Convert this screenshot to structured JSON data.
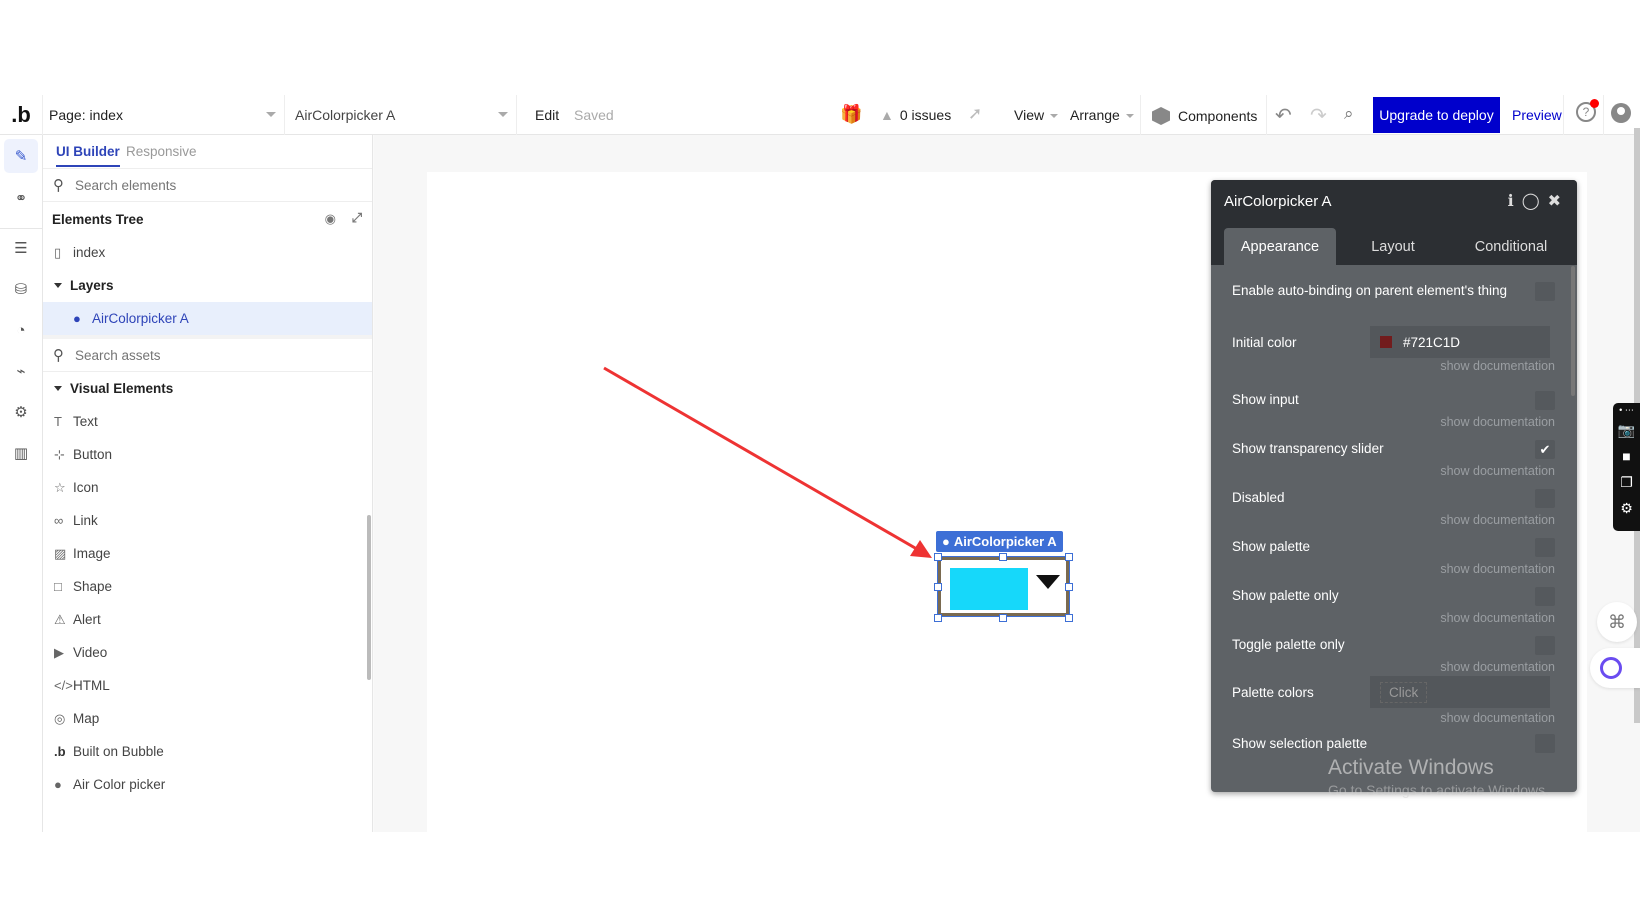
{
  "topbar": {
    "logo": ".b",
    "page_select": "Page: index",
    "element_select": "AirColorpicker A",
    "edit": "Edit",
    "saved": "Saved",
    "issues": "0 issues",
    "view": "View",
    "arrange": "Arrange",
    "components": "Components",
    "upgrade": "Upgrade to deploy",
    "preview": "Preview",
    "accent_color": "#0000CC"
  },
  "rail": {
    "items": [
      "design-pencil",
      "workflow",
      "data",
      "database",
      "styles",
      "plugins",
      "settings",
      "logs"
    ]
  },
  "panel": {
    "tabs": [
      "UI Builder",
      "Responsive"
    ],
    "search_elements_placeholder": "Search elements",
    "tree_title": "Elements Tree",
    "tree": {
      "page": "index",
      "layers": "Layers",
      "selected": "AirColorpicker A"
    },
    "search_assets_placeholder": "Search assets",
    "visual_elements": {
      "title": "Visual Elements",
      "items": [
        "Text",
        "Button",
        "Icon",
        "Link",
        "Image",
        "Shape",
        "Alert",
        "Video",
        "HTML",
        "Map",
        "Built on Bubble",
        "Air Color picker"
      ]
    }
  },
  "canvas": {
    "element_label": "AirColorpicker A",
    "swatch_color": "#16D8FA"
  },
  "props": {
    "title": "AirColorpicker A",
    "tabs": [
      "Appearance",
      "Layout",
      "Conditional"
    ],
    "doc_link": "show documentation",
    "auto_binding": {
      "label": "Enable auto-binding on parent element's thing",
      "checked": false
    },
    "initial_color": {
      "label": "Initial color",
      "value": "#721C1D",
      "swatch": "#721C1D"
    },
    "options": [
      {
        "label": "Show input",
        "checked": false
      },
      {
        "label": "Show transparency slider",
        "checked": true
      },
      {
        "label": "Disabled",
        "checked": false
      },
      {
        "label": "Show palette",
        "checked": false
      },
      {
        "label": "Show palette only",
        "checked": false
      },
      {
        "label": "Toggle palette only",
        "checked": false
      }
    ],
    "palette_colors": {
      "label": "Palette colors",
      "value": "Click"
    },
    "show_selection_palette": {
      "label": "Show selection palette",
      "checked": false
    }
  },
  "watermark": {
    "line1": "Activate Windows",
    "line2": "Go to Settings to activate Windows."
  }
}
